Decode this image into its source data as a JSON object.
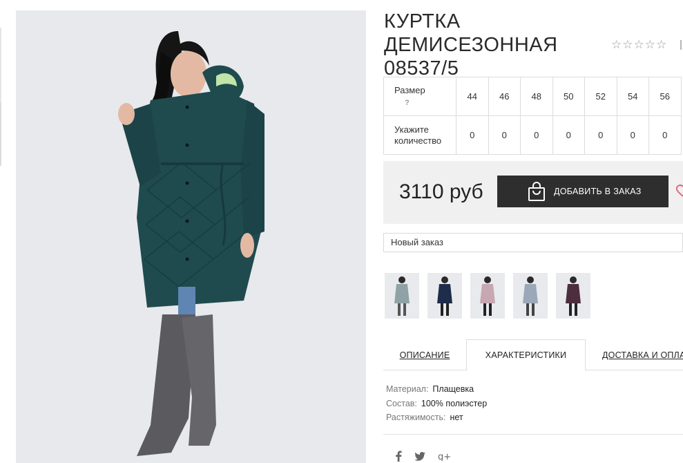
{
  "product": {
    "title_line1": "КУРТКА ДЕМИСЕЗОННАЯ",
    "title_line2": "08537/5",
    "rating": {
      "value": 0,
      "max": 5,
      "star_glyph": "☆"
    }
  },
  "size_table": {
    "size_label": "Размер",
    "help_mark": "?",
    "qty_label_line1": "Укажите",
    "qty_label_line2": "количество",
    "sizes": [
      "44",
      "46",
      "48",
      "50",
      "52",
      "54",
      "56"
    ],
    "quantities": [
      "0",
      "0",
      "0",
      "0",
      "0",
      "0",
      "0"
    ]
  },
  "purchase": {
    "price": "3110 руб",
    "add_button_label": "ДОБАВИТЬ В ЗАКАЗ",
    "order_select_value": "Новый заказ"
  },
  "tabs": [
    {
      "label": "ОПИСАНИЕ"
    },
    {
      "label": "ХАРАКТЕРИСТИКИ"
    },
    {
      "label": "ДОСТАВКА И ОПЛАТА"
    }
  ],
  "characteristics": [
    {
      "key": "Материал:",
      "value": "Плащевка"
    },
    {
      "key": "Состав:",
      "value": "100% полиэстер"
    },
    {
      "key": "Растяжимость:",
      "value": "нет"
    }
  ],
  "social": [
    {
      "icon": "facebook-icon",
      "glyph": "f"
    },
    {
      "icon": "twitter-icon",
      "glyph": "🐦"
    },
    {
      "icon": "google-plus-icon",
      "glyph": "g+"
    }
  ],
  "colors": {
    "coat_main": "#1f4b4f",
    "button_bg": "#2e2e2e",
    "price_box_bg": "#f0f0f0",
    "photo_bg": "#e8e9ec",
    "thumb_variants": [
      "#8fa3a6",
      "#1f2d4a",
      "#c7a7b2",
      "#9aa8ba",
      "#4d2e3e"
    ]
  }
}
